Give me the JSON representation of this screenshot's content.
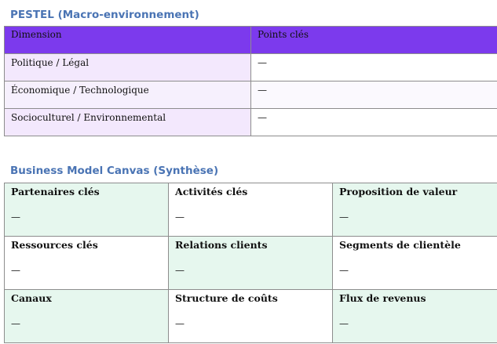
{
  "pestel": {
    "title": "PESTEL (Macro-environnement)",
    "headers": [
      "Dimension",
      "Points clés"
    ],
    "rows": [
      {
        "dimension": "Politique / Légal",
        "points": "—"
      },
      {
        "dimension": "Économique / Technologique",
        "points": "—"
      },
      {
        "dimension": "Socioculturel / Environnemental",
        "points": "—"
      }
    ]
  },
  "bmc": {
    "title": "Business Model Canvas (Synthèse)",
    "cells": [
      {
        "title": "Partenaires clés",
        "value": "—"
      },
      {
        "title": "Activités clés",
        "value": "—"
      },
      {
        "title": "Proposition de valeur",
        "value": "—"
      },
      {
        "title": "Ressources clés",
        "value": "—"
      },
      {
        "title": "Relations clients",
        "value": "—"
      },
      {
        "title": "Segments de clientèle",
        "value": "—"
      },
      {
        "title": "Canaux",
        "value": "—"
      },
      {
        "title": "Structure de coûts",
        "value": "—"
      },
      {
        "title": "Flux de revenus",
        "value": "—"
      }
    ]
  },
  "colors": {
    "heading": "#4a74b4",
    "table_header": "#7c3aed",
    "dimension_cell": "#f3e8fd",
    "canvas_highlight": "#e6f7ee"
  }
}
